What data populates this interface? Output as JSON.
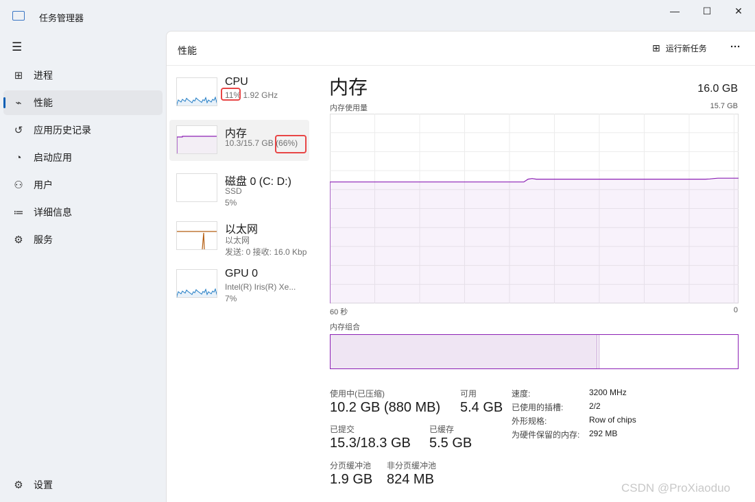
{
  "window": {
    "title": "任务管理器",
    "minimize": "—",
    "maximize": "☐",
    "close": "✕"
  },
  "nav": {
    "menu_icon": "☰",
    "items": [
      {
        "label": "进程",
        "icon": "processes-icon",
        "glyph": "⊞"
      },
      {
        "label": "性能",
        "icon": "performance-icon",
        "glyph": "⌁"
      },
      {
        "label": "应用历史记录",
        "icon": "history-icon",
        "glyph": "↺"
      },
      {
        "label": "启动应用",
        "icon": "startup-icon",
        "glyph": "◔"
      },
      {
        "label": "用户",
        "icon": "users-icon",
        "glyph": "⚇"
      },
      {
        "label": "详细信息",
        "icon": "details-icon",
        "glyph": "≔"
      },
      {
        "label": "服务",
        "icon": "services-icon",
        "glyph": "⚙"
      }
    ],
    "settings": "设置"
  },
  "header": {
    "title": "性能",
    "run_task": "运行新任务",
    "more": "···"
  },
  "devices": [
    {
      "name": "CPU",
      "sub1": "11%",
      "sub1b": "1.92 GHz",
      "color": "#1f7bc4"
    },
    {
      "name": "内存",
      "sub1": "10.3/15.7 GB",
      "sub1b": "(66%)",
      "color": "#8b1fb4"
    },
    {
      "name": "磁盘 0 (C: D:)",
      "sub1": "SSD",
      "sub2": "5%",
      "color": "#4ca81e"
    },
    {
      "name": "以太网",
      "sub1": "以太网",
      "sub2": "发送: 0 接收: 16.0 Kbp",
      "color": "#b45d10"
    },
    {
      "name": "GPU 0",
      "sub1": "Intel(R) Iris(R) Xe...",
      "sub2": "7%",
      "color": "#1f7bc4"
    }
  ],
  "memory": {
    "title": "内存",
    "total": "16.0 GB",
    "usage_label": "内存使用量",
    "usage_max": "15.7 GB",
    "x_left": "60 秒",
    "x_right": "0",
    "composition_label": "内存组合",
    "in_use_fraction": 0.655,
    "accent": "#8b1fb4",
    "usage_series": [
      64,
      64,
      64,
      64,
      64,
      64,
      64,
      64,
      64,
      64,
      64,
      64,
      64,
      64,
      64,
      64,
      64,
      64,
      64,
      64,
      64,
      64,
      64,
      64,
      64,
      64,
      64,
      64,
      64,
      64,
      64,
      64,
      64,
      64,
      64,
      64,
      64,
      64,
      64,
      64,
      64,
      64,
      64,
      64,
      64,
      64,
      64,
      64,
      65.5,
      65.8,
      65.5,
      65.5,
      65.5,
      65.5,
      65.5,
      65.5,
      65.5,
      65.5,
      65.5,
      65.5,
      65.5,
      65.5,
      65.5,
      65.5,
      65.5,
      65.5,
      65.5,
      65.5,
      65.5,
      65.5,
      65.5,
      65.5,
      65.5,
      65.5,
      65.5,
      65.5,
      65.5,
      65.5,
      65.5,
      65.5,
      65.5,
      65.5,
      65.5,
      65.5,
      65.5,
      65.5,
      65.5,
      65.5,
      65.5,
      65.5,
      65.5,
      65.5,
      65.6,
      65.8,
      66,
      66,
      66,
      66,
      66,
      66
    ],
    "stats": {
      "in_use_label": "使用中(已压缩)",
      "in_use": "10.2 GB (880 MB)",
      "available_label": "可用",
      "available": "5.4 GB",
      "committed_label": "已提交",
      "committed": "15.3/18.3 GB",
      "cached_label": "已缓存",
      "cached": "5.5 GB",
      "paged_label": "分页缓冲池",
      "paged": "1.9 GB",
      "nonpaged_label": "非分页缓冲池",
      "nonpaged": "824 MB"
    },
    "props": [
      {
        "k": "速度:",
        "v": "3200 MHz"
      },
      {
        "k": "已使用的插槽:",
        "v": "2/2"
      },
      {
        "k": "外形规格:",
        "v": "Row of chips"
      },
      {
        "k": "为硬件保留的内存:",
        "v": "292 MB"
      }
    ]
  },
  "watermark": "CSDN @ProXiaoduo"
}
